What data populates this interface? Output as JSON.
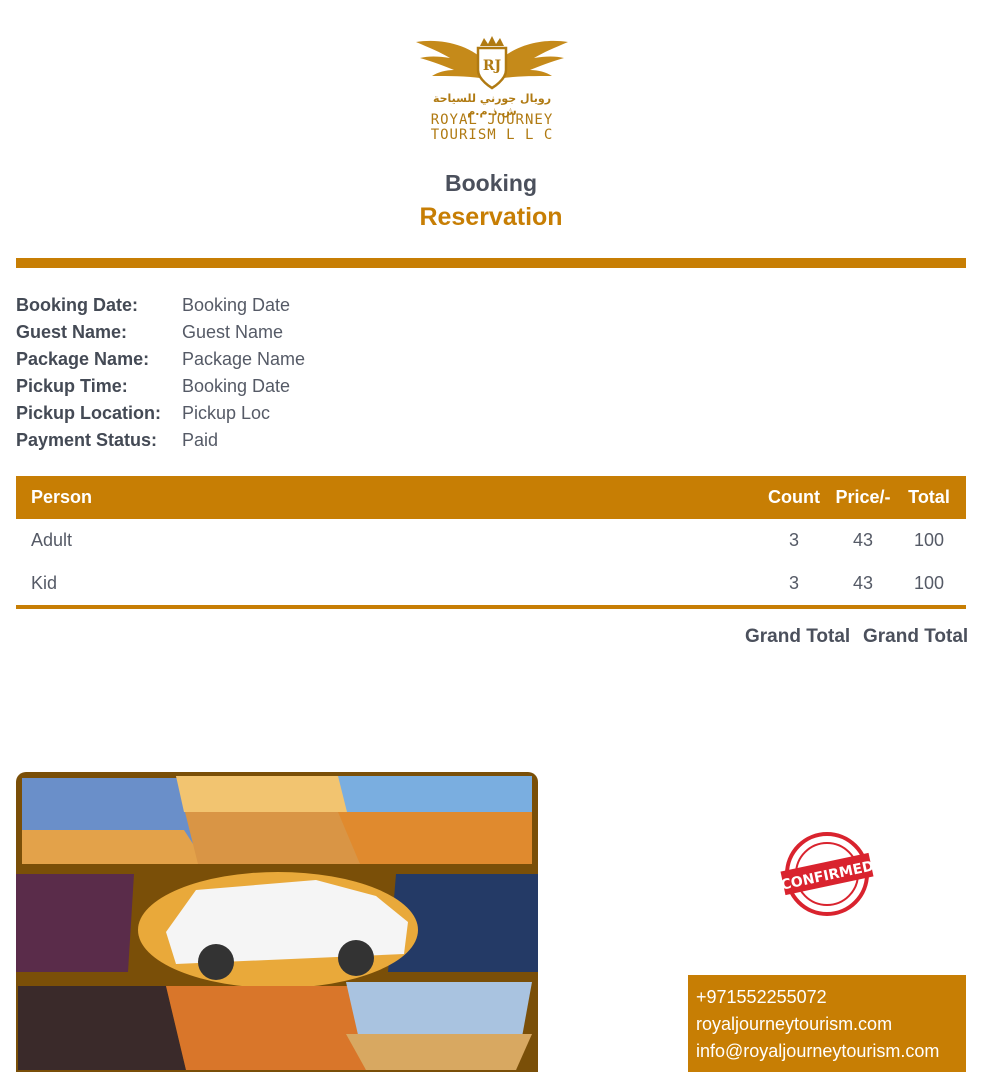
{
  "logo": {
    "monogram": "RJ",
    "arabic": "رويال جورني للسياحة ش.ذ.م.م",
    "line1": "ROYAL JOURNEY",
    "line2": "TOURISM L L C"
  },
  "header": {
    "title": "Booking",
    "subtitle": "Reservation"
  },
  "details": [
    {
      "label": "Booking Date:",
      "value": "Booking Date"
    },
    {
      "label": "Guest Name:",
      "value": "Guest Name"
    },
    {
      "label": "Package Name:",
      "value": "Package Name"
    },
    {
      "label": "Pickup Time:",
      "value": "Booking Date"
    },
    {
      "label": "Pickup Location:",
      "value": "Pickup Loc"
    },
    {
      "label": "Payment Status:",
      "value": "Paid"
    }
  ],
  "table": {
    "headers": {
      "person": "Person",
      "count": "Count",
      "price": "Price/-",
      "total": "Total"
    },
    "rows": [
      {
        "person": "Adult",
        "count": "3",
        "price": "43",
        "total": "100"
      },
      {
        "person": "Kid",
        "count": "3",
        "price": "43",
        "total": "100"
      }
    ]
  },
  "grand_total": {
    "label": "Grand Total",
    "value": "Grand Total"
  },
  "stamp": {
    "text": "CONFIRMED",
    "color": "#d9232e"
  },
  "contact": {
    "phone": "+971552255072",
    "website": "royaljourneytourism.com",
    "email": "info@royaljourneytourism.com"
  },
  "colors": {
    "accent": "#c77e04",
    "text": "#444a55"
  }
}
